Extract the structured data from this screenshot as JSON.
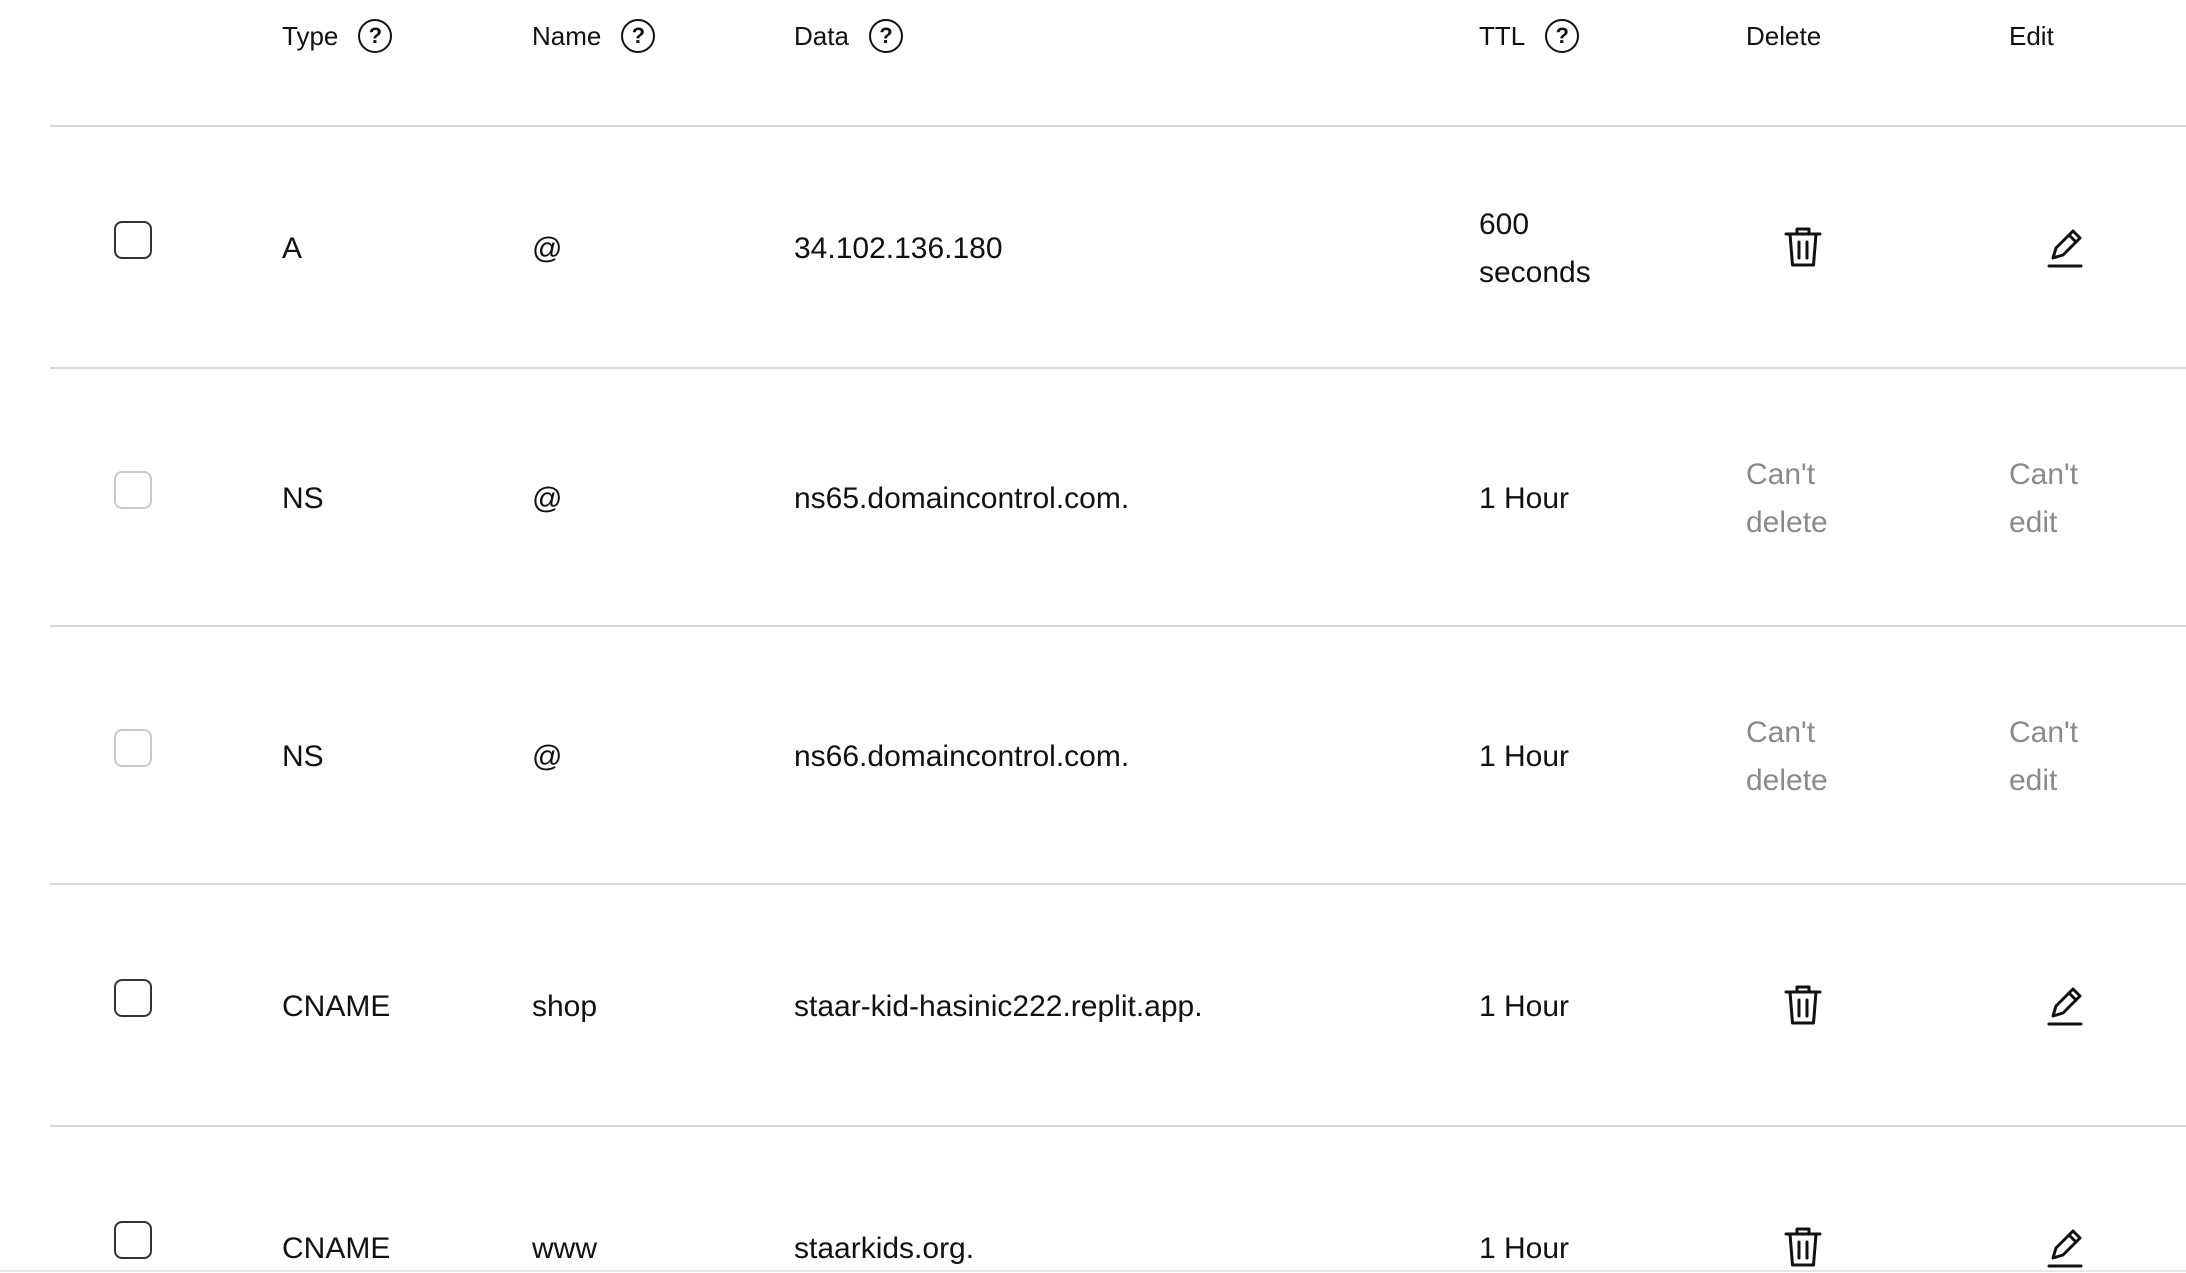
{
  "columns": {
    "type": "Type",
    "name": "Name",
    "data": "Data",
    "ttl": "TTL",
    "delete": "Delete",
    "edit": "Edit"
  },
  "help_glyph": "?",
  "records": [
    {
      "type": "A",
      "name": "@",
      "data": "34.102.136.180",
      "ttl": "600 seconds",
      "deletable": true,
      "editable": true
    },
    {
      "type": "NS",
      "name": "@",
      "data": "ns65.domaincontrol.com.",
      "ttl": "1 Hour",
      "deletable": false,
      "editable": false,
      "delete_text": "Can't delete",
      "edit_text": "Can't edit"
    },
    {
      "type": "NS",
      "name": "@",
      "data": "ns66.domaincontrol.com.",
      "ttl": "1 Hour",
      "deletable": false,
      "editable": false,
      "delete_text": "Can't delete",
      "edit_text": "Can't edit"
    },
    {
      "type": "CNAME",
      "name": "shop",
      "data": "staar-kid-hasinic222.replit.app.",
      "ttl": "1 Hour",
      "deletable": true,
      "editable": true
    },
    {
      "type": "CNAME",
      "name": "www",
      "data": "staarkids.org.",
      "ttl": "1 Hour",
      "deletable": true,
      "editable": true
    }
  ],
  "icons": {
    "delete": "trash-icon",
    "edit": "pencil-icon",
    "help": "question-circle-icon"
  },
  "colors": {
    "text": "#111111",
    "muted": "#8a8a8a",
    "divider": "#d8d8d8"
  }
}
